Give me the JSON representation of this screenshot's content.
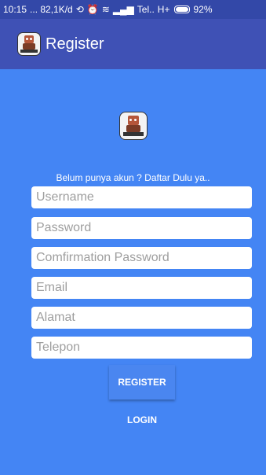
{
  "status_bar": {
    "time": "10:15",
    "info": "... 82,1K/d",
    "carrier": "Tel..",
    "network": "H+",
    "battery": "92%"
  },
  "toolbar": {
    "title": "Register",
    "icon": "app-logo-icon"
  },
  "form": {
    "prompt": "Belum punya akun ? Daftar Dulu ya..",
    "username_placeholder": "Username",
    "password_placeholder": "Password",
    "confirm_placeholder": "Comfirmation Password",
    "email_placeholder": "Email",
    "alamat_placeholder": "Alamat",
    "telepon_placeholder": "Telepon",
    "register_label": "REGISTER",
    "login_label": "LOGIN"
  },
  "colors": {
    "status_bar": "#3348a8",
    "toolbar": "#3f51b5",
    "background": "#4485f4"
  }
}
